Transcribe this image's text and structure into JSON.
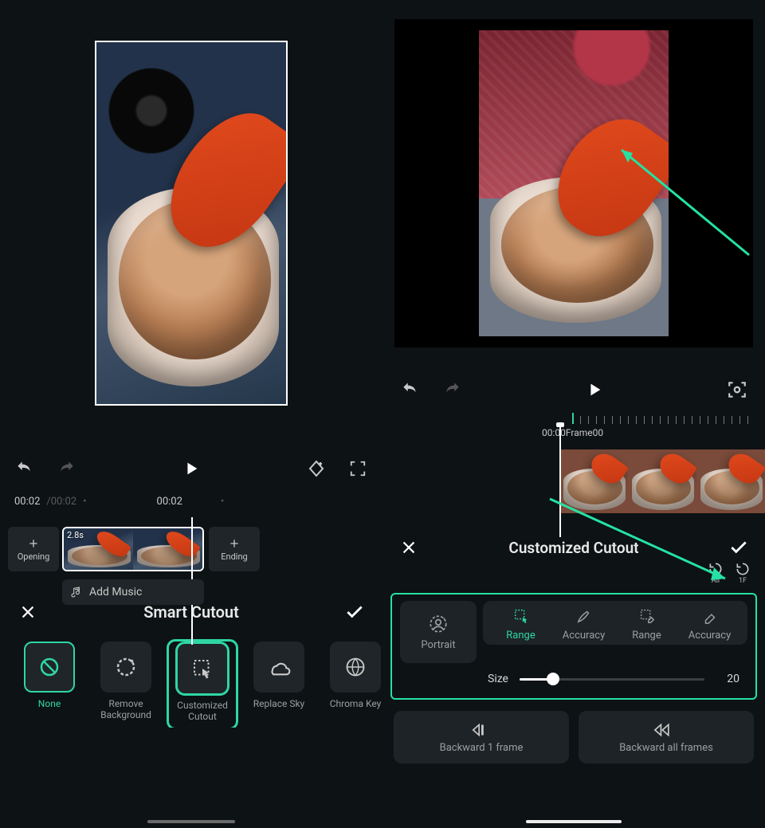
{
  "left": {
    "time_current": "00:02",
    "time_total": "/00:02",
    "time_mid": "00:02",
    "clip_duration": "2.8s",
    "opening": "Opening",
    "ending": "Ending",
    "add_music": "Add Music",
    "panel_title": "Smart Cutout",
    "tools": {
      "none": "None",
      "remove_bg_l1": "Remove",
      "remove_bg_l2": "Background",
      "custom_l1": "Customized",
      "custom_l2": "Cutout",
      "replace_sky": "Replace Sky",
      "chroma": "Chroma Key"
    }
  },
  "right": {
    "ruler_label": "00:00Frame00",
    "panel_title": "Customized Cutout",
    "reset_all": "All",
    "reset_1f": "1F",
    "portrait": "Portrait",
    "tabs": {
      "range_paint": "Range",
      "accuracy_paint": "Accuracy",
      "range_erase": "Range",
      "accuracy_erase": "Accuracy"
    },
    "size_label": "Size",
    "size_value": "20",
    "backward1": "Backward 1 frame",
    "backward_all": "Backward all frames"
  }
}
